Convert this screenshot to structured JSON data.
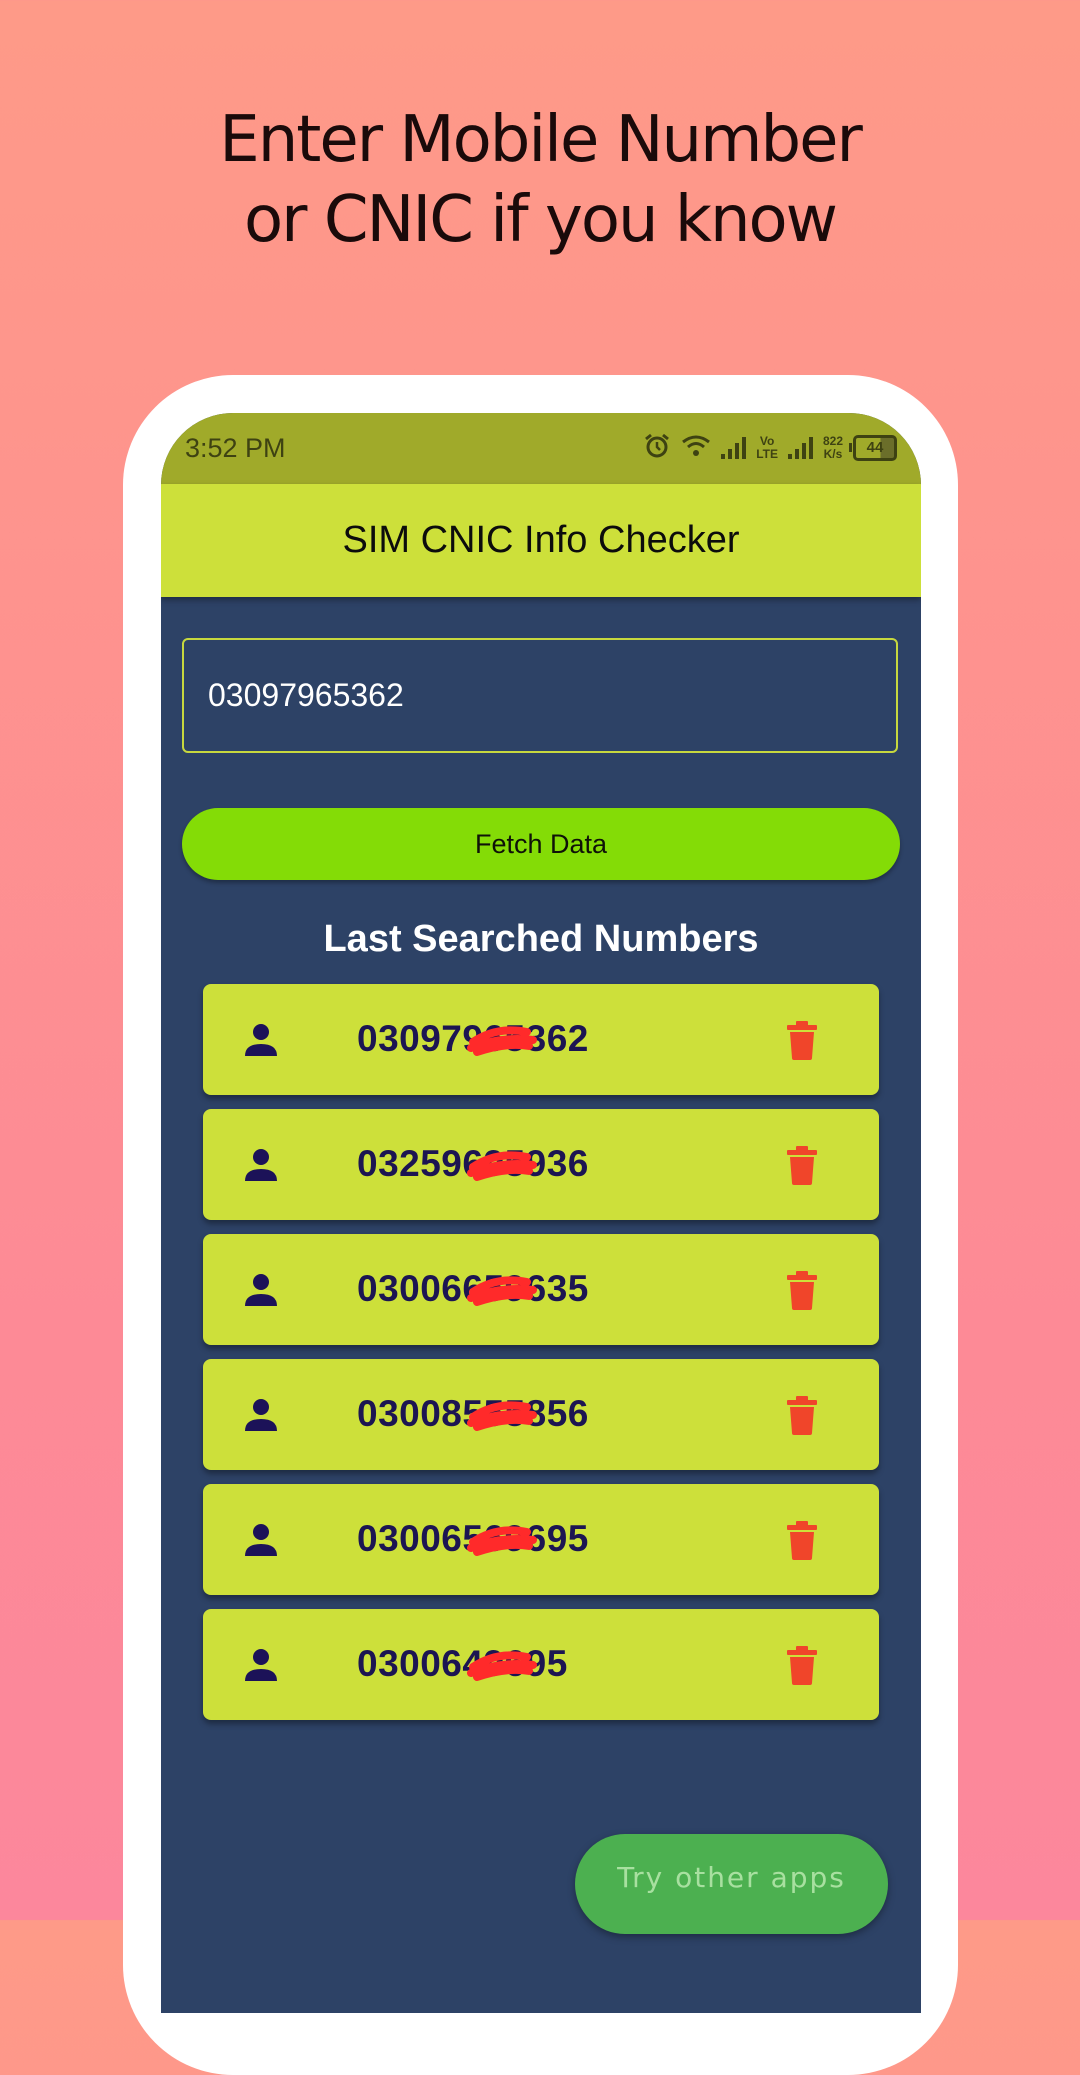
{
  "headline": {
    "line1": "Enter Mobile Number",
    "line2": "or CNIC if you know"
  },
  "status_bar": {
    "time": "3:52 PM",
    "icons": [
      "alarm-icon",
      "wifi-icon",
      "signal-icon",
      "volte-icon",
      "signal-icon",
      "network-speed",
      "battery-icon"
    ],
    "volte_top": "Vo",
    "volte_bottom": "LTE",
    "speed_value": "822",
    "speed_unit": "K/s",
    "battery_level": "44"
  },
  "app_bar": {
    "title": "SIM CNIC Info Checker"
  },
  "search": {
    "value": "03097965362"
  },
  "fetch_button": {
    "label": "Fetch Data"
  },
  "history": {
    "title": "Last Searched Numbers",
    "items": [
      {
        "number": "03097965362",
        "redacted": true
      },
      {
        "number": "03259695936",
        "redacted": true
      },
      {
        "number": "03006659635",
        "redacted": true
      },
      {
        "number": "03008555856",
        "redacted": true
      },
      {
        "number": "03006569695",
        "redacted": true
      },
      {
        "number": "0300649695",
        "redacted": true
      }
    ]
  },
  "try_other_apps": {
    "label": "Try other apps"
  },
  "colors": {
    "background_top": "#fe9a88",
    "background_bottom": "#fc879c",
    "status_bar": "#a0aa2a",
    "app_bar": "#cde03a",
    "screen_bg": "#2d4266",
    "fetch_button": "#84dc06",
    "row_bg": "#cde03a",
    "number_text": "#1c1552",
    "trash": "#f0452a",
    "try_button": "#4cb050",
    "redaction": "#ff2a2a"
  }
}
